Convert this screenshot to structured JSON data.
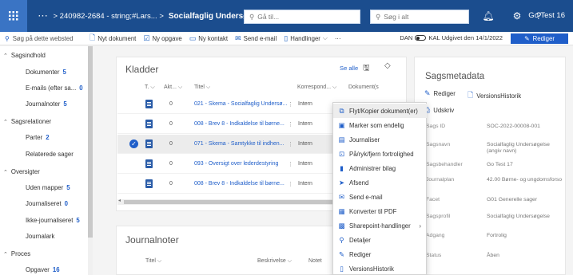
{
  "topbar": {
    "ellipsis": "···",
    "breadcrumb_path": "> 240982-2684 - string;#Lars... >",
    "title": "Socialfaglig Undersøgelse (angiv b...",
    "search1_placeholder": "Gå til...",
    "search2_placeholder": "Søg i alt",
    "user": "Go Test 16",
    "bell_count": "1"
  },
  "cmdbar": {
    "site_search": "Søg på dette websted",
    "new_document": "Nyt dokument",
    "new_task": "Ny opgave",
    "new_contact": "Ny kontakt",
    "send_email": "Send e-mail",
    "actions": "Handlinger",
    "more": "···",
    "status_text_left": "DAN",
    "status_text_right": "KAL Udgivet den 14/1/2022",
    "edit_button": "Rediger"
  },
  "leftnav": [
    {
      "type": "group",
      "label": "Sagsindhold",
      "count": ""
    },
    {
      "type": "sub",
      "label": "Dokumenter",
      "count": "5"
    },
    {
      "type": "sub",
      "label": "E-mails (efter sa...",
      "count": "0"
    },
    {
      "type": "sub",
      "label": "Journalnoter",
      "count": "5"
    },
    {
      "type": "group",
      "label": "Sagsrelationer",
      "count": ""
    },
    {
      "type": "sub",
      "label": "Parter",
      "count": "2"
    },
    {
      "type": "sub",
      "label": "Relaterede sager",
      "count": ""
    },
    {
      "type": "group",
      "label": "Oversigter",
      "count": ""
    },
    {
      "type": "sub",
      "label": "Uden mapper",
      "count": "5"
    },
    {
      "type": "sub",
      "label": "Journaliseret",
      "count": "0"
    },
    {
      "type": "sub",
      "label": "Ikke-journaliseret",
      "count": "5"
    },
    {
      "type": "sub",
      "label": "Journalark",
      "count": ""
    },
    {
      "type": "group",
      "label": "Proces",
      "count": ""
    },
    {
      "type": "sub",
      "label": "Opgaver",
      "count": "16"
    }
  ],
  "kladder": {
    "title": "Kladder",
    "see_all": "Se alle",
    "columns": [
      "T.",
      "Akt...",
      "Titel",
      "Korrespond...",
      "Dokument(s"
    ],
    "rows": [
      {
        "akt": "0",
        "title": "021 - Skema - Socialfaglig Undersø...",
        "korr": "Intern",
        "selected": false
      },
      {
        "akt": "0",
        "title": "008 - Brev 8 - Indkaldelse til børne...",
        "korr": "Intern",
        "selected": false
      },
      {
        "akt": "0",
        "title": "071 - Skema - Samtykke til indhen...",
        "korr": "Intern",
        "selected": true
      },
      {
        "akt": "0",
        "title": "093 - Oversigt over lederdestyring",
        "korr": "Intern",
        "selected": false
      },
      {
        "akt": "0",
        "title": "008 - Brev 8 - Indkaldelse til børne...",
        "korr": "Intern",
        "selected": false
      }
    ]
  },
  "journal": {
    "title": "Journalnoter",
    "columns": [
      "Titel",
      "Beskrivelse",
      "Notet"
    ]
  },
  "metadata": {
    "title": "Sagsmetadata",
    "actions": [
      "Rediger",
      "VersionsHistorik",
      "Udskriv"
    ],
    "fields": [
      {
        "label": "Sags ID",
        "value": "SOC-2022-00008-001"
      },
      {
        "label": "Sagsnavn",
        "value": "Socialfaglig Undersøgelse (angiv navn)"
      },
      {
        "label": "Sagsbehandler",
        "value": "Go Test 17"
      },
      {
        "label": "Journalplan",
        "value": "42.00 Børne- og ungdomsforso"
      },
      {
        "label": "Facet",
        "value": "G01 Generelle sager"
      },
      {
        "label": "Sagsprofil",
        "value": "Socialfaglig Undersøgelse"
      },
      {
        "label": "Adgang",
        "value": "Fortrolig"
      },
      {
        "label": "Status",
        "value": "Åben"
      }
    ]
  },
  "context_menu": [
    {
      "label": "Flyt/Kopier dokument(er)",
      "icon": "move-icon",
      "hover": true
    },
    {
      "label": "Marker som endelig",
      "icon": "finalize-icon",
      "hover": false
    },
    {
      "label": "Journaliser",
      "icon": "journal-icon",
      "hover": false
    },
    {
      "label": "På/ryk/fjern fortrolighed",
      "icon": "lock-icon",
      "hover": false
    },
    {
      "label": "Administrer bilag",
      "icon": "attachment-icon",
      "hover": false
    },
    {
      "label": "Afsend",
      "icon": "send-icon",
      "hover": false
    },
    {
      "label": "Send e-mail",
      "icon": "mail-icon",
      "hover": false
    },
    {
      "label": "Konverter til PDF",
      "icon": "pdf-icon",
      "hover": false
    },
    {
      "label": "Sharepoint-handlinger",
      "icon": "sharepoint-icon",
      "hover": false,
      "submenu": true
    },
    {
      "label": "Detaljer",
      "icon": "details-icon",
      "hover": false
    },
    {
      "label": "Rediger",
      "icon": "edit-icon",
      "hover": false
    },
    {
      "label": "VersionsHistorik",
      "icon": "history-icon",
      "hover": false
    }
  ],
  "colors": {
    "suite_bar": "#1b4d8e",
    "accent": "#1f5ec9"
  }
}
